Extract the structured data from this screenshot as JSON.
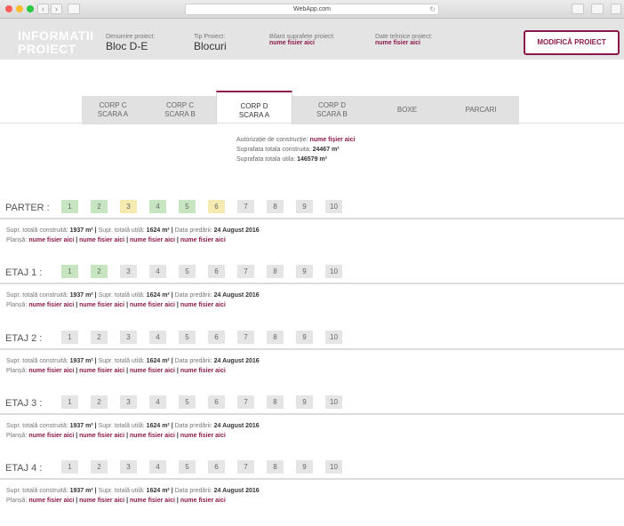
{
  "browser": {
    "url": "WebApp.com",
    "back": "‹",
    "forward": "›",
    "reload": "↻"
  },
  "header": {
    "title": "INFORMATII PROIECT",
    "denumire_label": "Denumire proiect:",
    "denumire_value": "Bloc D-E",
    "tip_label": "Tip Proiect:",
    "tip_value": "Blocuri",
    "bilant_label": "Bilant suprafete proiect:",
    "bilant_link": "nume fisier aici",
    "date_label": "Date tehnice proiect:",
    "date_link": "nume fisier aici",
    "modify_button": "MODIFICĂ PROIECT"
  },
  "tabs": [
    {
      "line1": "CORP C",
      "line2": "SCARA A"
    },
    {
      "line1": "CORP C",
      "line2": "SCARA B"
    },
    {
      "line1": "CORP D",
      "line2": "SCARA A"
    },
    {
      "line1": "CORP D",
      "line2": "SCARA B"
    },
    {
      "line1": "BOXE",
      "line2": ""
    },
    {
      "line1": "PARCARI",
      "line2": ""
    }
  ],
  "info": {
    "autorizatie_label": "Autorizație de construcție:",
    "autorizatie_link": "nume fișier aici",
    "construita_label": "Suprafata totala construita:",
    "construita_value": "24467 m²",
    "utila_label": "Suprafata totala utila:",
    "utila_value": "146579 m²"
  },
  "floor_template": {
    "constr_label": "Supr. totală construită:",
    "constr_value": "1937 m²",
    "utila_label": "Supr. totală utilă:",
    "utila_value": "1624 m²",
    "data_label": "Data predării:",
    "data_value": "24 August 2016",
    "plansa_label": "Planșă:",
    "link": "nume fisier aici",
    "sep": "|"
  },
  "floors": [
    {
      "label": "PARTER :",
      "apartments": [
        {
          "n": "1",
          "status": "green"
        },
        {
          "n": "2",
          "status": "green"
        },
        {
          "n": "3",
          "status": "yellow"
        },
        {
          "n": "4",
          "status": "green"
        },
        {
          "n": "5",
          "status": "green"
        },
        {
          "n": "6",
          "status": "yellow"
        },
        {
          "n": "7",
          "status": "grey"
        },
        {
          "n": "8",
          "status": "grey"
        },
        {
          "n": "9",
          "status": "grey"
        },
        {
          "n": "10",
          "status": "grey"
        }
      ]
    },
    {
      "label": "ETAJ 1 :",
      "apartments": [
        {
          "n": "1",
          "status": "green"
        },
        {
          "n": "2",
          "status": "green"
        },
        {
          "n": "3",
          "status": "grey"
        },
        {
          "n": "4",
          "status": "grey"
        },
        {
          "n": "5",
          "status": "grey"
        },
        {
          "n": "6",
          "status": "grey"
        },
        {
          "n": "7",
          "status": "grey"
        },
        {
          "n": "8",
          "status": "grey"
        },
        {
          "n": "9",
          "status": "grey"
        },
        {
          "n": "10",
          "status": "grey"
        }
      ]
    },
    {
      "label": "ETAJ 2 :",
      "apartments": [
        {
          "n": "1",
          "status": "grey"
        },
        {
          "n": "2",
          "status": "grey"
        },
        {
          "n": "3",
          "status": "grey"
        },
        {
          "n": "4",
          "status": "grey"
        },
        {
          "n": "5",
          "status": "grey"
        },
        {
          "n": "6",
          "status": "grey"
        },
        {
          "n": "7",
          "status": "grey"
        },
        {
          "n": "8",
          "status": "grey"
        },
        {
          "n": "9",
          "status": "grey"
        },
        {
          "n": "10",
          "status": "grey"
        }
      ]
    },
    {
      "label": "ETAJ 3 :",
      "apartments": [
        {
          "n": "1",
          "status": "grey"
        },
        {
          "n": "2",
          "status": "grey"
        },
        {
          "n": "3",
          "status": "grey"
        },
        {
          "n": "4",
          "status": "grey"
        },
        {
          "n": "5",
          "status": "grey"
        },
        {
          "n": "6",
          "status": "grey"
        },
        {
          "n": "7",
          "status": "grey"
        },
        {
          "n": "8",
          "status": "grey"
        },
        {
          "n": "9",
          "status": "grey"
        },
        {
          "n": "10",
          "status": "grey"
        }
      ]
    },
    {
      "label": "ETAJ 4 :",
      "apartments": [
        {
          "n": "1",
          "status": "grey"
        },
        {
          "n": "2",
          "status": "grey"
        },
        {
          "n": "3",
          "status": "grey"
        },
        {
          "n": "4",
          "status": "grey"
        },
        {
          "n": "5",
          "status": "grey"
        },
        {
          "n": "6",
          "status": "grey"
        },
        {
          "n": "7",
          "status": "grey"
        },
        {
          "n": "8",
          "status": "grey"
        },
        {
          "n": "9",
          "status": "grey"
        },
        {
          "n": "10",
          "status": "grey"
        }
      ]
    }
  ]
}
